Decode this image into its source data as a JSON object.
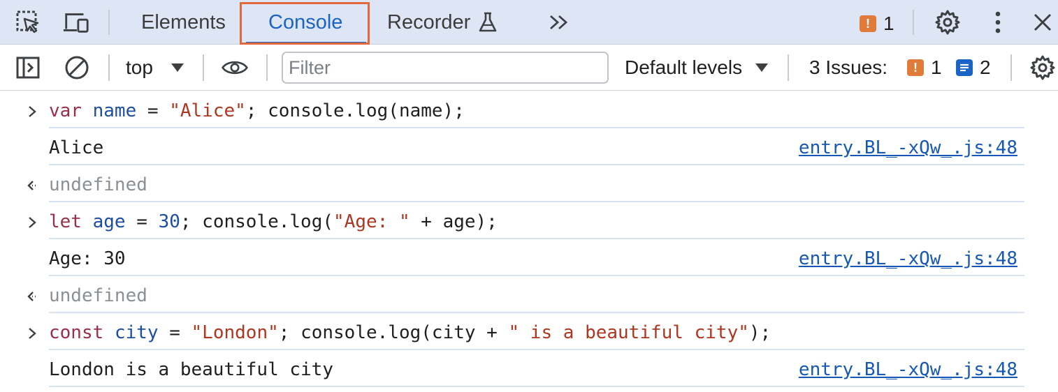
{
  "tabs": {
    "elements": "Elements",
    "console": "Console",
    "recorder": "Recorder"
  },
  "header": {
    "issue_count": "1",
    "issue_badge_glyph": "!"
  },
  "toolbar": {
    "context": "top",
    "filter_placeholder": "Filter",
    "levels": "Default levels",
    "issues_label": "3 Issues:",
    "warn_count": "1",
    "info_count": "2"
  },
  "colors": {
    "tab_bar_bg": "#dee6f5",
    "active_tab": "#1a63c7",
    "highlight_box": "#e2673b",
    "warning_badge": "#e07b39",
    "info_badge": "#1a63c7",
    "keyword": "#9c2e4a",
    "variable": "#1c4ea5",
    "string": "#b0361f",
    "link": "#1658b5"
  },
  "console": {
    "entries": [
      {
        "type": "input",
        "tokens": [
          {
            "t": "var",
            "c": "k"
          },
          {
            "t": " ",
            "c": "p"
          },
          {
            "t": "name",
            "c": "v"
          },
          {
            "t": " = ",
            "c": "p"
          },
          {
            "t": "\"Alice\"",
            "c": "s"
          },
          {
            "t": "; console.log(name);",
            "c": "p"
          }
        ]
      },
      {
        "type": "log",
        "text": "Alice",
        "source": "entry.BL_-xQw_.js:48"
      },
      {
        "type": "result",
        "text": "undefined"
      },
      {
        "type": "input",
        "tokens": [
          {
            "t": "let",
            "c": "k"
          },
          {
            "t": " ",
            "c": "p"
          },
          {
            "t": "age",
            "c": "v"
          },
          {
            "t": " = ",
            "c": "p"
          },
          {
            "t": "30",
            "c": "n"
          },
          {
            "t": "; console.log(",
            "c": "p"
          },
          {
            "t": "\"Age: \"",
            "c": "s"
          },
          {
            "t": " + age);",
            "c": "p"
          }
        ]
      },
      {
        "type": "log",
        "text": "Age: 30",
        "source": "entry.BL_-xQw_.js:48"
      },
      {
        "type": "result",
        "text": "undefined"
      },
      {
        "type": "input",
        "tokens": [
          {
            "t": "const",
            "c": "k"
          },
          {
            "t": " ",
            "c": "p"
          },
          {
            "t": "city",
            "c": "v"
          },
          {
            "t": " = ",
            "c": "p"
          },
          {
            "t": "\"London\"",
            "c": "s"
          },
          {
            "t": "; console.log(city + ",
            "c": "p"
          },
          {
            "t": "\" is a beautiful city\"",
            "c": "s"
          },
          {
            "t": ");",
            "c": "p"
          }
        ]
      },
      {
        "type": "log",
        "text": "London is a beautiful city",
        "source": "entry.BL_-xQw_.js:48"
      }
    ]
  }
}
